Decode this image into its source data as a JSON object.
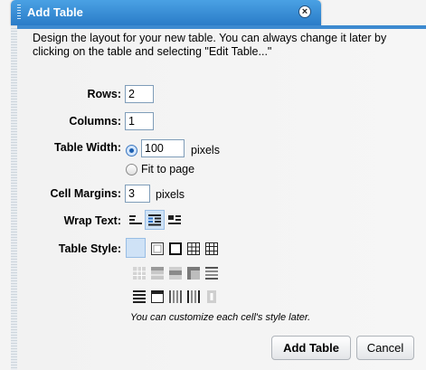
{
  "dialog": {
    "title": "Add Table",
    "close_icon": "close-circle-icon",
    "intro": "Design the layout for your new table. You can always change it later by clicking on the table and selecting \"Edit Table...\""
  },
  "rows": {
    "label": "Rows:",
    "value": "2"
  },
  "columns": {
    "label": "Columns:",
    "value": "1"
  },
  "table_width": {
    "label": "Table Width:",
    "value": "100",
    "unit": "pixels",
    "fit_label": "Fit to page",
    "selected": "pixels"
  },
  "cell_margins": {
    "label": "Cell Margins:",
    "value": "3",
    "unit": "pixels"
  },
  "wrap_text": {
    "label": "Wrap Text:",
    "options": [
      "wrap-left-icon",
      "wrap-center-icon",
      "wrap-right-icon"
    ],
    "selected": 1
  },
  "table_style": {
    "label": "Table Style:",
    "note": "You can customize each cell's style later.",
    "selected": 0
  },
  "buttons": {
    "add": "Add Table",
    "cancel": "Cancel"
  },
  "colors": {
    "accent": "#2a7cc8",
    "selection": "#cfe2f6"
  }
}
